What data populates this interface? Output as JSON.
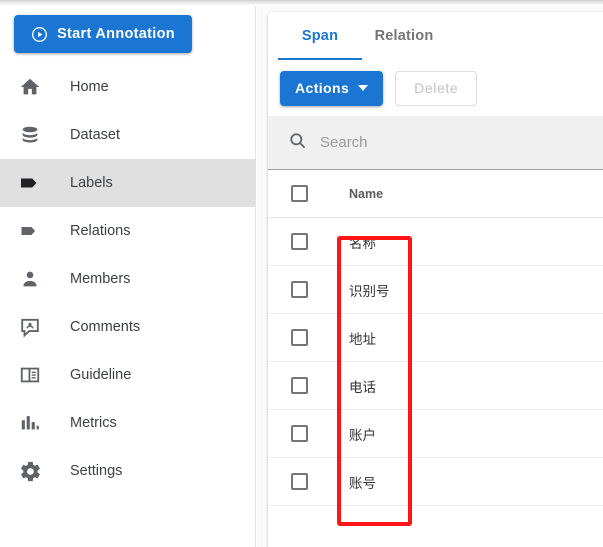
{
  "sidebar": {
    "start_button": {
      "label": "Start Annotation",
      "icon": "play-circle-icon",
      "color": "#1a76d2"
    },
    "items": [
      {
        "label": "Home",
        "icon": "home-icon",
        "active": false
      },
      {
        "label": "Dataset",
        "icon": "database-icon",
        "active": false
      },
      {
        "label": "Labels",
        "icon": "tag-filled-icon",
        "active": true
      },
      {
        "label": "Relations",
        "icon": "tag-icon",
        "active": false
      },
      {
        "label": "Members",
        "icon": "person-icon",
        "active": false
      },
      {
        "label": "Comments",
        "icon": "comment-icon",
        "active": false
      },
      {
        "label": "Guideline",
        "icon": "guideline-icon",
        "active": false
      },
      {
        "label": "Metrics",
        "icon": "bar-chart-icon",
        "active": false
      },
      {
        "label": "Settings",
        "icon": "gear-icon",
        "active": false
      }
    ]
  },
  "main": {
    "tabs": [
      {
        "label": "Span",
        "active": true
      },
      {
        "label": "Relation",
        "active": false
      }
    ],
    "toolbar": {
      "actions_label": "Actions",
      "delete_label": "Delete",
      "actions_icon": "chevron-down-icon",
      "delete_disabled": true
    },
    "search": {
      "placeholder": "Search",
      "value": "",
      "icon": "search-icon"
    },
    "table": {
      "columns": [
        "Name"
      ],
      "header_checkbox_checked": false,
      "rows": [
        {
          "name": "名称",
          "checked": false
        },
        {
          "name": "识别号",
          "checked": false
        },
        {
          "name": "地址",
          "checked": false
        },
        {
          "name": "电话",
          "checked": false
        },
        {
          "name": "账户",
          "checked": false
        },
        {
          "name": "账号",
          "checked": false
        }
      ]
    }
  },
  "annotation": {
    "highlight_color": "#fe1616",
    "target": "name-column-cells"
  }
}
